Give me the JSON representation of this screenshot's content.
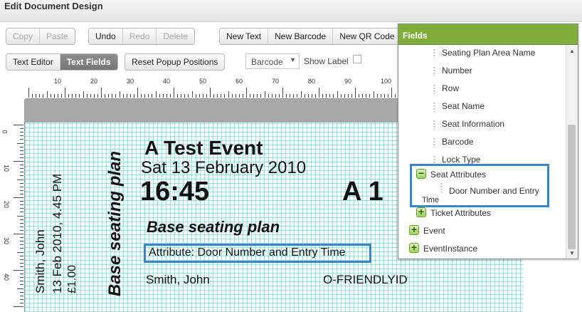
{
  "window": {
    "title": "Edit Document Design"
  },
  "toolbar": {
    "copy": "Copy",
    "paste": "Paste",
    "undo": "Undo",
    "redo": "Redo",
    "delete": "Delete",
    "new_text": "New Text",
    "new_barcode": "New Barcode",
    "new_qr": "New QR Code"
  },
  "toolbar2": {
    "text_editor": "Text Editor",
    "text_fields": "Text Fields",
    "reset_popups": "Reset Popup Positions",
    "barcode_select": "Barcode",
    "show_label": "Show Label"
  },
  "ruler": {
    "h_labels": [
      "10",
      "20",
      "30",
      "40",
      "50",
      "60",
      "70",
      "80",
      "90",
      "100"
    ],
    "v_labels": [
      "0",
      "10",
      "20",
      "30",
      "40"
    ]
  },
  "ticket": {
    "side_name": "Smith, John",
    "side_date": "13 Feb 2010, 4.45 PM",
    "side_price": "£1.00",
    "side_plan": "Base seating plan",
    "event_name": "A Test Event",
    "event_date": "Sat 13 February 2010",
    "time": "16:45",
    "seat": "A 1",
    "plan": "Base seating plan",
    "attribute": "Attribute: Door Number and Entry Time",
    "customer": "Smith, John",
    "friendly_id": "O-FRIENDLYID"
  },
  "fields_panel": {
    "title": "Fields",
    "items": [
      "Seating Plan Area Name",
      "Number",
      "Row",
      "Seat Name",
      "Seat Information",
      "Barcode",
      "Lock Type"
    ],
    "seat_attributes": "Seat Attributes",
    "door_entry_a": "Door Number and Entry",
    "door_entry_b": "Time",
    "ticket_attributes": "Ticket Attributes",
    "event": "Event",
    "event_instance": "EventInstance"
  },
  "colors": {
    "header_green": "#7fae3c",
    "highlight_blue": "#3a86c4",
    "grid_cyan": "#46cdcd"
  }
}
